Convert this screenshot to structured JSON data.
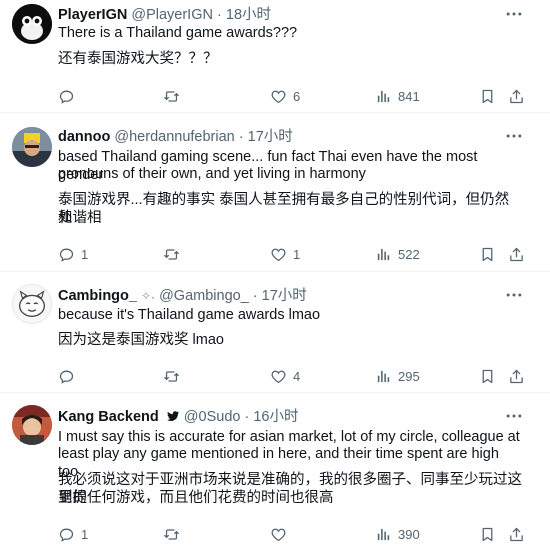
{
  "tweets": [
    {
      "name": "PlayerIGN",
      "handle": "@PlayerIGN",
      "sep": "·",
      "time": "18小时",
      "text_en": "There is a Thailand game awards???",
      "text_zh": "还有泰国游戏大奖？？？",
      "reply_count": "",
      "retweet_count": "",
      "like_count": "6",
      "view_count": "841"
    },
    {
      "name": "dannoo",
      "handle": "@herdannufebrian",
      "sep": "·",
      "time": "17小时",
      "text_en_1": "based Thailand gaming scene... fun fact Thai even have the most gender",
      "text_en_2": "pronouns of their own, and yet living in harmony",
      "text_zh_1": "泰国游戏界...有趣的事实 泰国人甚至拥有最多自己的性别代词，但仍然和谐相",
      "text_zh_2": "处",
      "reply_count": "1",
      "retweet_count": "",
      "like_count": "1",
      "view_count": "522"
    },
    {
      "name": "Cambingo_",
      "handle": "@Gambingo_",
      "sep": "·",
      "time": "17小时",
      "text_en": "because it's Thailand game awards lmao",
      "text_zh": "因为这是泰国游戏奖 lmao",
      "reply_count": "",
      "retweet_count": "",
      "like_count": "4",
      "view_count": "295"
    },
    {
      "name": "Kang Backend",
      "handle": "@0Sudo",
      "sep": "·",
      "time": "16小时",
      "text_en_1": "I must say this is accurate for asian market, lot of my circle, colleague at",
      "text_en_2": "least play any game mentioned in here, and their time spent are high too",
      "text_zh_1": "我必须说这对于亚洲市场来说是准确的，我的很多圈子、同事至少玩过这里提",
      "text_zh_2": "到的任何游戏，而且他们花费的时间也很高",
      "reply_count": "1",
      "retweet_count": "",
      "like_count": "",
      "view_count": "390"
    }
  ],
  "icons": {
    "reply": "reply-icon",
    "retweet": "retweet-icon",
    "like": "like-icon",
    "views": "views-icon",
    "bookmark": "bookmark-icon",
    "share": "share-icon",
    "more": "more-icon",
    "badge": "bird-badge-icon",
    "emoji": "sparkles-emoji"
  },
  "colors": {
    "text": "#0f1419",
    "secondary": "#536471",
    "divider": "#eff3f4"
  }
}
